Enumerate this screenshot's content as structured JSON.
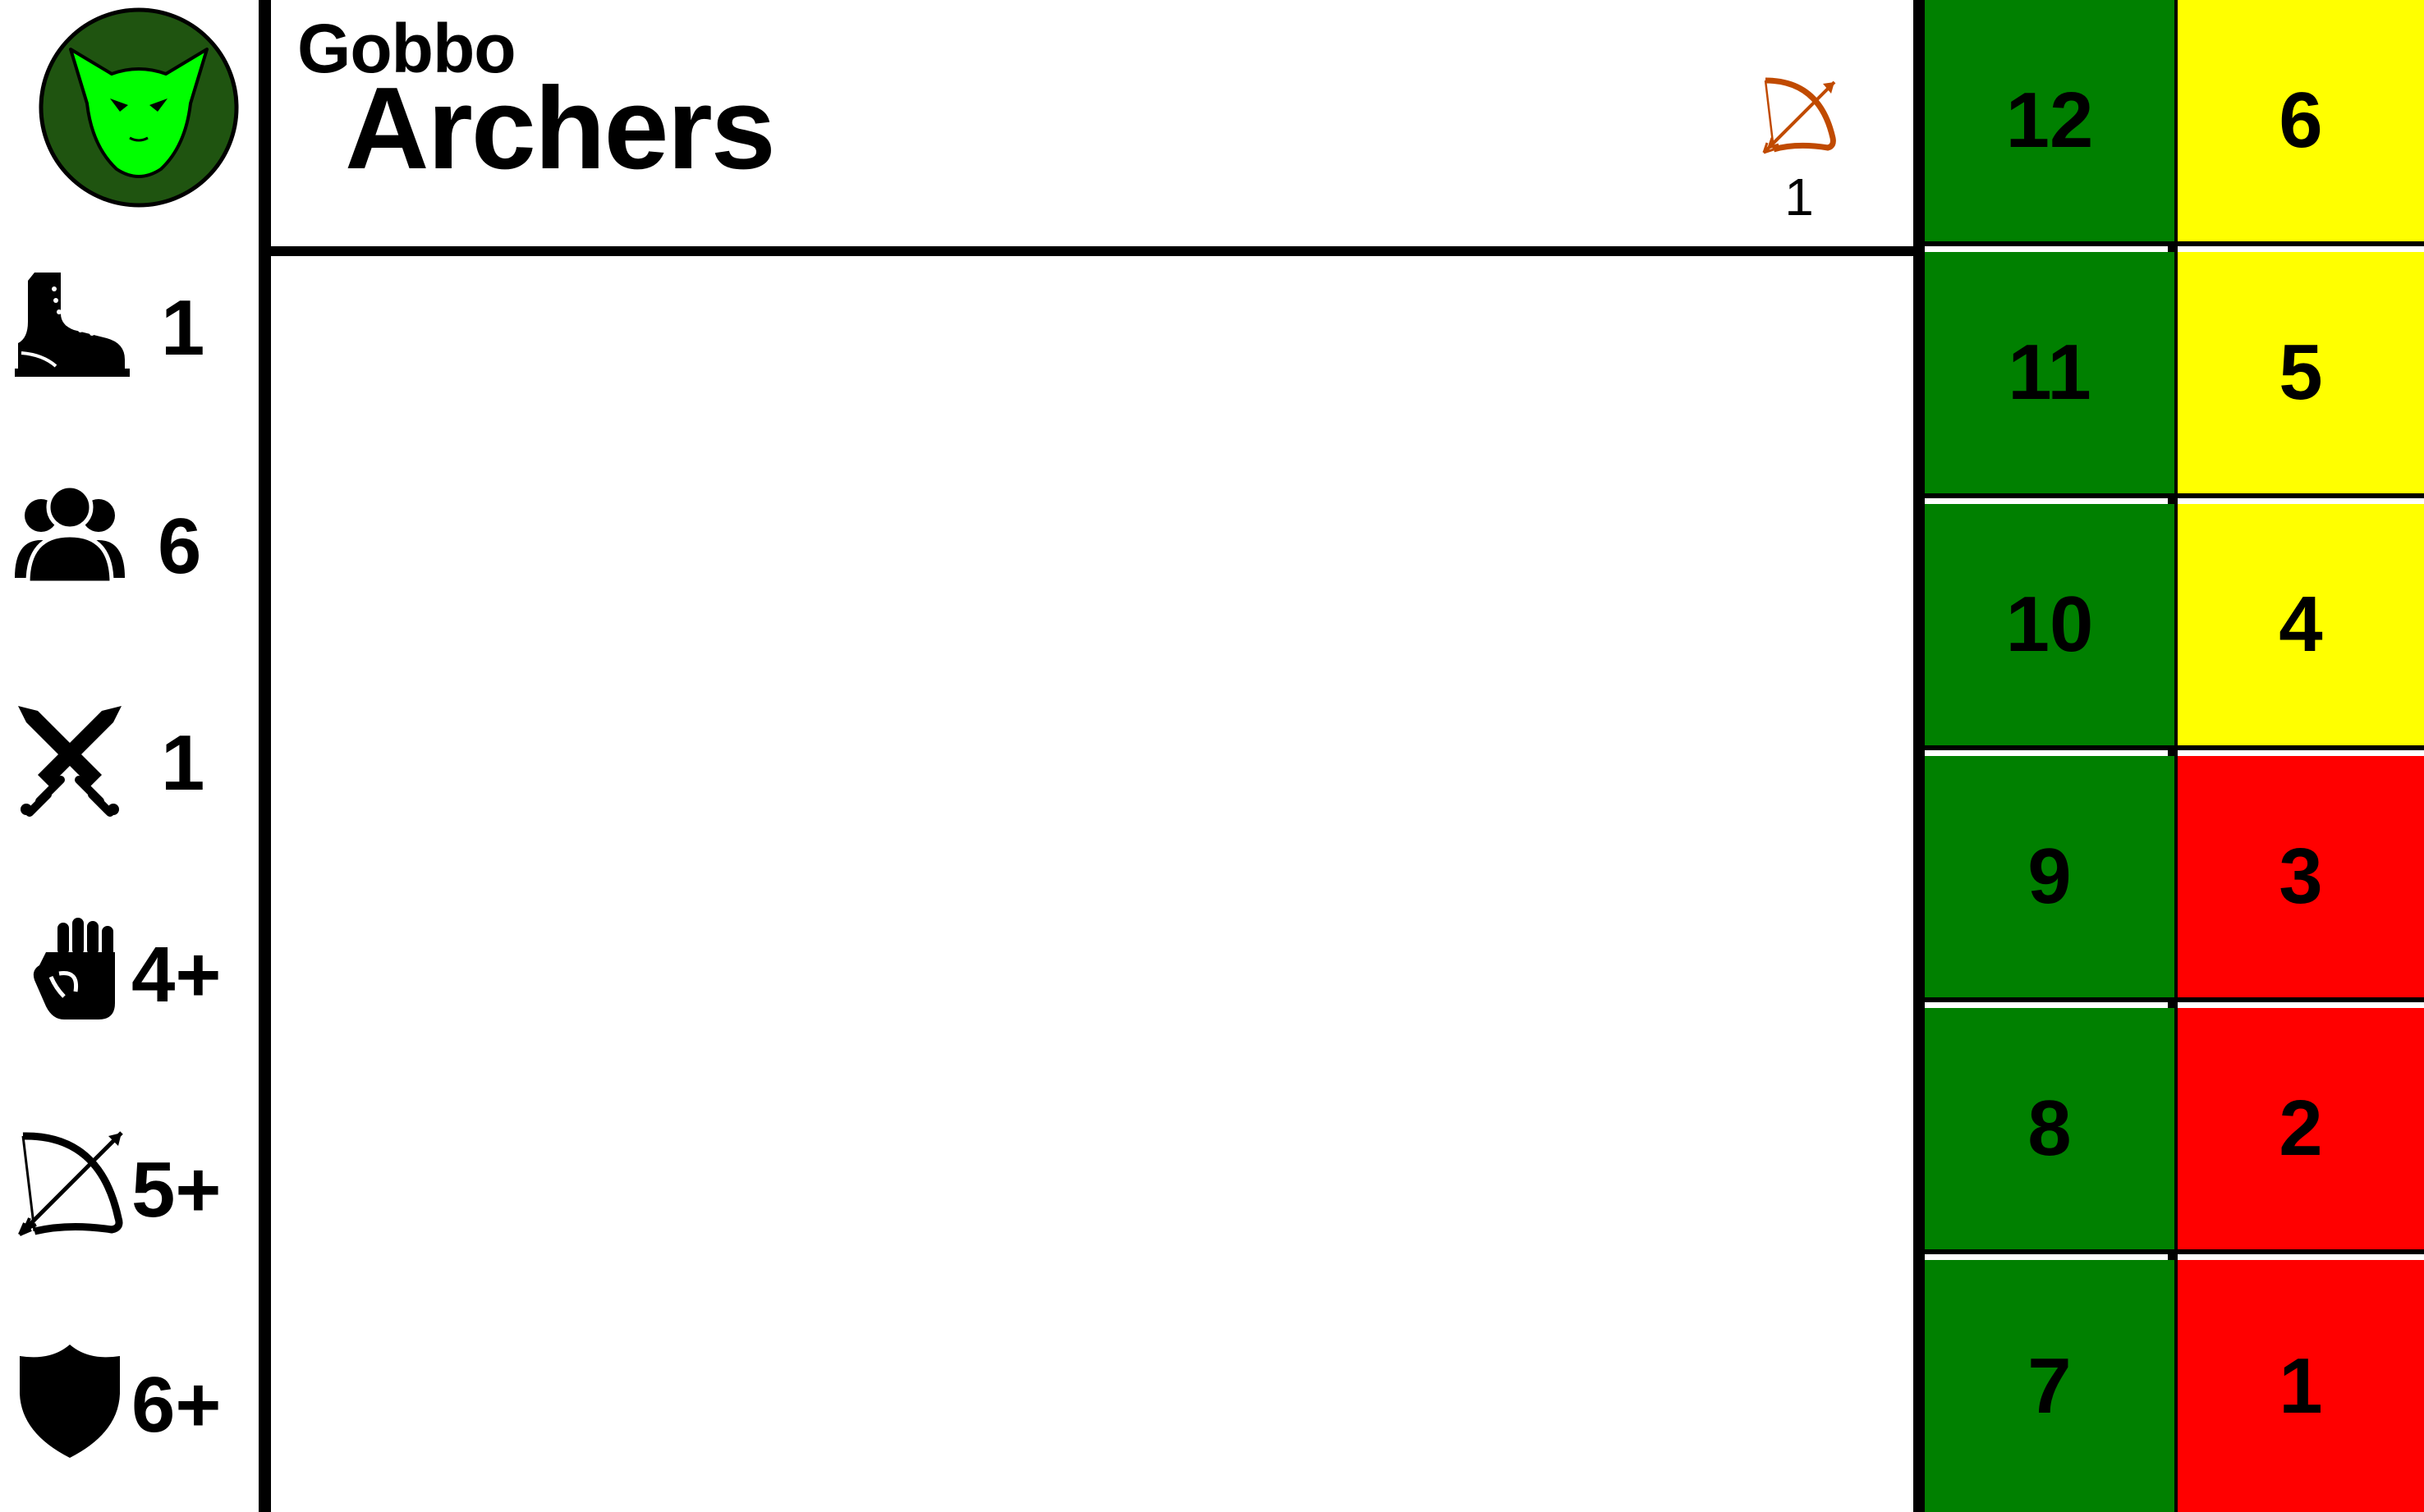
{
  "unit": {
    "faction": "Gobbo",
    "name": "Archers"
  },
  "faction_badge": {
    "icon": "goblin-head-icon",
    "ring_color": "#1f5410",
    "face_color": "#00ff00"
  },
  "stats": [
    {
      "key": "move",
      "icon": "boot-icon",
      "value": "1"
    },
    {
      "key": "models",
      "icon": "group-icon",
      "value": "6"
    },
    {
      "key": "attacks",
      "icon": "crossed-swords-icon",
      "value": "1"
    },
    {
      "key": "melee",
      "icon": "fist-icon",
      "value": "4+"
    },
    {
      "key": "ranged",
      "icon": "bow-icon",
      "value": "5+"
    },
    {
      "key": "save",
      "icon": "shield-icon",
      "value": "6+"
    }
  ],
  "weapon": {
    "icon": "bow-icon",
    "color": "#c04a00",
    "count": "1"
  },
  "tracks": {
    "left": {
      "color": "#008000",
      "values": [
        "12",
        "11",
        "10",
        "9",
        "8",
        "7"
      ]
    },
    "right": {
      "colors": [
        "#ffff00",
        "#ffff00",
        "#ffff00",
        "#ff0000",
        "#ff0000",
        "#ff0000"
      ],
      "values": [
        "6",
        "5",
        "4",
        "3",
        "2",
        "1"
      ]
    }
  }
}
